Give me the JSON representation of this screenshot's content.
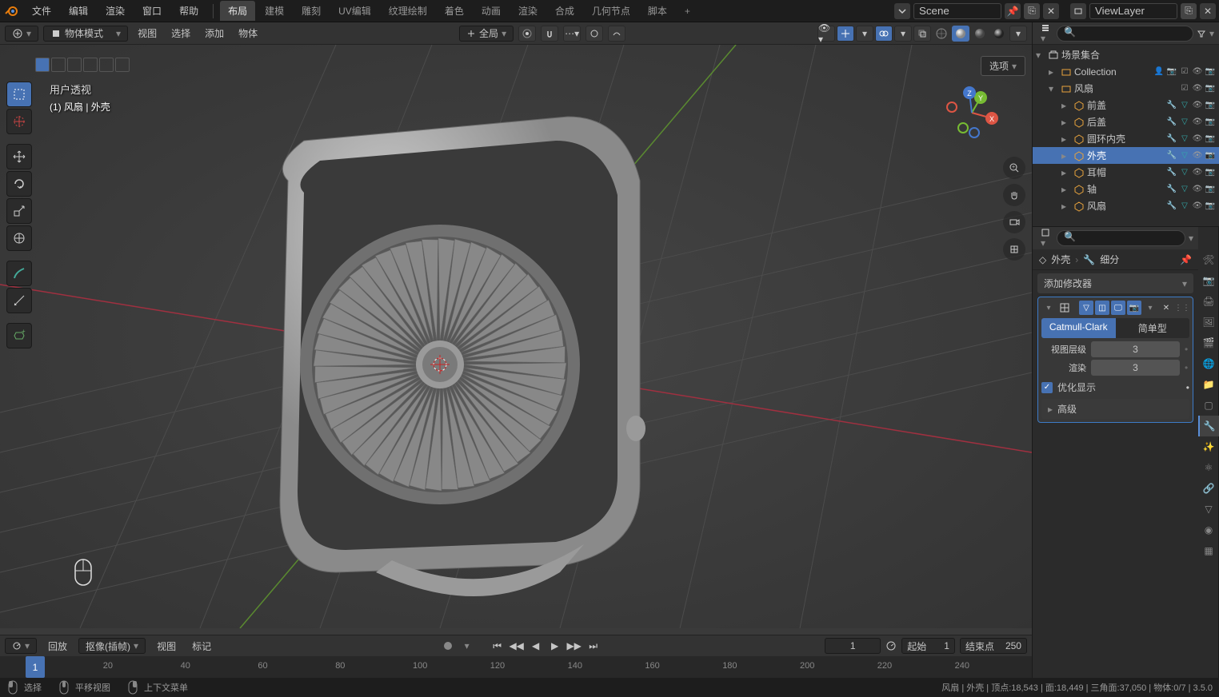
{
  "menu": {
    "file": "文件",
    "edit": "编辑",
    "render": "渲染",
    "window": "窗口",
    "help": "帮助"
  },
  "workspaces": {
    "layout": "布局",
    "modeling": "建模",
    "sculpting": "雕刻",
    "uv": "UV编辑",
    "texture": "纹理绘制",
    "shading": "着色",
    "animation": "动画",
    "rendering": "渲染",
    "compositing": "合成",
    "geo": "几何节点",
    "scripting": "脚本"
  },
  "topbar": {
    "scene_label": "Scene",
    "viewlayer_label": "ViewLayer"
  },
  "vp_header": {
    "mode": "物体模式",
    "view": "视图",
    "select": "选择",
    "add": "添加",
    "object": "物体",
    "orient": "全局",
    "options": "选项"
  },
  "vp_info": {
    "perspective": "用户透视",
    "context": "(1) 风扇 | 外壳"
  },
  "timeline": {
    "playback": "回放",
    "keying": "抠像(插帧)",
    "view": "视图",
    "marker": "标记",
    "current_frame": "1",
    "start_label": "起始",
    "start_value": "1",
    "end_label": "结束点",
    "end_value": "250",
    "ticks": [
      "20",
      "40",
      "60",
      "80",
      "100",
      "120",
      "140",
      "160",
      "180",
      "200",
      "220",
      "240"
    ]
  },
  "status": {
    "select": "选择",
    "pan": "平移视图",
    "context_menu": "上下文菜单",
    "stats": "风扇 | 外壳 | 顶点:18,543 | 面:18,449 | 三角面:37,050 | 物体:0/7 | 3.5.0"
  },
  "outliner": {
    "root": "场景集合",
    "collection": "Collection",
    "fan_coll": "风扇",
    "items": [
      "前盖",
      "后盖",
      "圆环内壳",
      "外壳",
      "耳帽",
      "轴",
      "风扇"
    ],
    "active_index": 3
  },
  "props": {
    "breadcrumb_obj": "外壳",
    "breadcrumb_mod": "细分",
    "add_modifier": "添加修改器",
    "mod_type_a": "Catmull-Clark",
    "mod_type_b": "简单型",
    "viewport_levels_label": "视图层级",
    "viewport_levels": "3",
    "render_levels_label": "渲染",
    "render_levels": "3",
    "optimal_display": "优化显示",
    "advanced": "高级"
  }
}
